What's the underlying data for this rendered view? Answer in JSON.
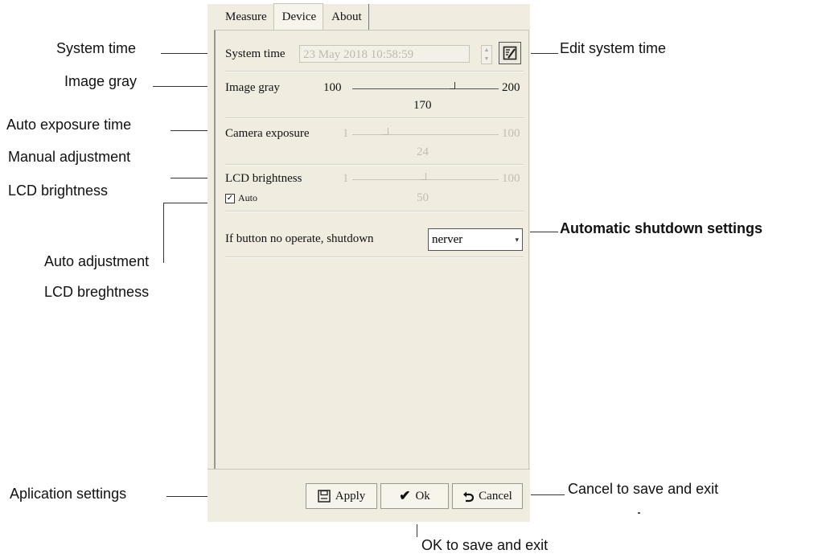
{
  "tabs": [
    "Measure",
    "Device",
    "About"
  ],
  "active_tab": 1,
  "system_time": {
    "label": "System time",
    "value": "23 May 2018 10:58:59"
  },
  "image_gray": {
    "label": "Image gray",
    "min": "100",
    "max": "200",
    "value": "170",
    "level": 0.7
  },
  "camera_exposure": {
    "label": "Camera exposure",
    "min": "1",
    "max": "100",
    "value": "24",
    "level": 0.24
  },
  "lcd_brightness": {
    "label": "LCD brightness",
    "min": "1",
    "max": "100",
    "value": "50",
    "level": 0.5,
    "auto_label": "Auto",
    "auto_checked": true
  },
  "shutdown": {
    "label": "If button no operate,  shutdown",
    "selected": "nerver"
  },
  "buttons": {
    "apply": "Apply",
    "ok": "Ok",
    "cancel": "Cancel"
  },
  "annotations": {
    "system_time": "System time",
    "image_gray": "Image gray",
    "auto_exposure": "Auto exposure time",
    "manual_adjust_1": "Manual adjustment",
    "manual_adjust_2": "LCD brightness",
    "auto_adjust_1": "Auto adjustment",
    "auto_adjust_2": "LCD breghtness",
    "app_settings": "Aplication settings",
    "edit_time": "Edit system time",
    "auto_shutdown": "Automatic shutdown settings",
    "cancel_exit": "Cancel to save and exit",
    "ok_exit": "OK to save and exit"
  }
}
